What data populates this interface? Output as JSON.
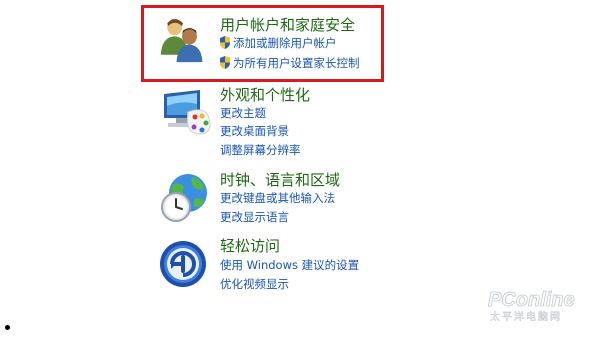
{
  "categories": {
    "user_accounts": {
      "title": "用户帐户和家庭安全",
      "links": [
        "添加或删除用户帐户",
        "为所有用户设置家长控制"
      ]
    },
    "appearance": {
      "title": "外观和个性化",
      "links": [
        "更改主题",
        "更改桌面背景",
        "调整屏幕分辨率"
      ]
    },
    "clock_language": {
      "title": "时钟、语言和区域",
      "links": [
        "更改键盘或其他输入法",
        "更改显示语言"
      ]
    },
    "ease_of_access": {
      "title": "轻松访问",
      "links": [
        "使用 Windows 建议的设置",
        "优化视频显示"
      ]
    }
  },
  "watermark": {
    "text": "PConline",
    "subtext": "太平洋电脑网"
  },
  "colors": {
    "highlight_border": "#d9191c",
    "category_title": "#1d6a12",
    "link": "#1a55b8"
  }
}
